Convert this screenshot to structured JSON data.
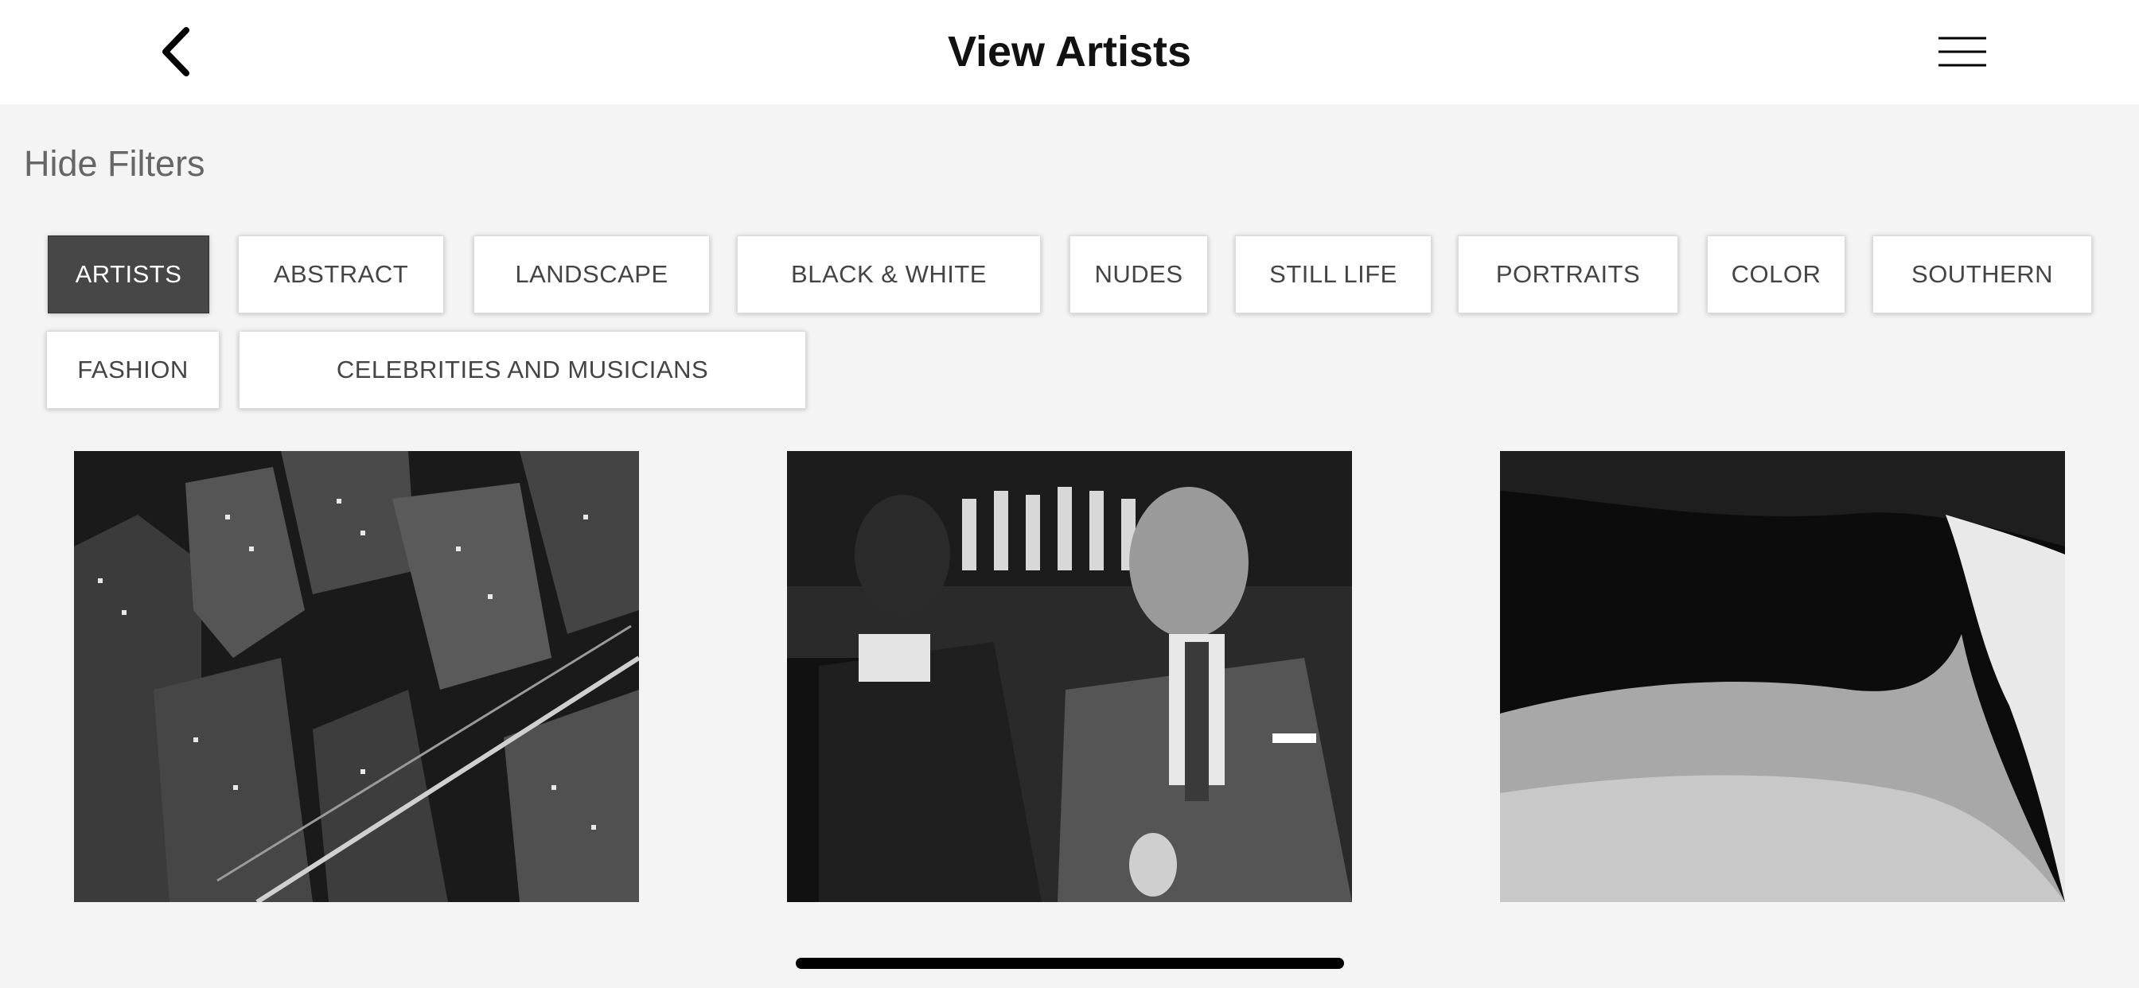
{
  "header": {
    "title": "View Artists",
    "back_icon": "chevron-left-icon",
    "menu_icon": "hamburger-menu-icon"
  },
  "filters": {
    "toggle_label": "Hide Filters",
    "active_index": 0,
    "chips": [
      {
        "label": "ARTISTS"
      },
      {
        "label": "ABSTRACT"
      },
      {
        "label": "LANDSCAPE"
      },
      {
        "label": "BLACK & WHITE"
      },
      {
        "label": "NUDES"
      },
      {
        "label": "STILL LIFE"
      },
      {
        "label": "PORTRAITS"
      },
      {
        "label": "COLOR"
      },
      {
        "label": "SOUTHERN"
      },
      {
        "label": "FASHION"
      },
      {
        "label": "CELEBRITIES AND MUSICIANS"
      }
    ]
  },
  "gallery": {
    "images": [
      {
        "subject": "aerial-city-night-photo"
      },
      {
        "subject": "two-men-at-bar-photo"
      },
      {
        "subject": "sand-dune-photo"
      }
    ]
  },
  "colors": {
    "active_chip": "#474747",
    "page_background": "#f4f4f4",
    "header_background": "#ffffff"
  }
}
